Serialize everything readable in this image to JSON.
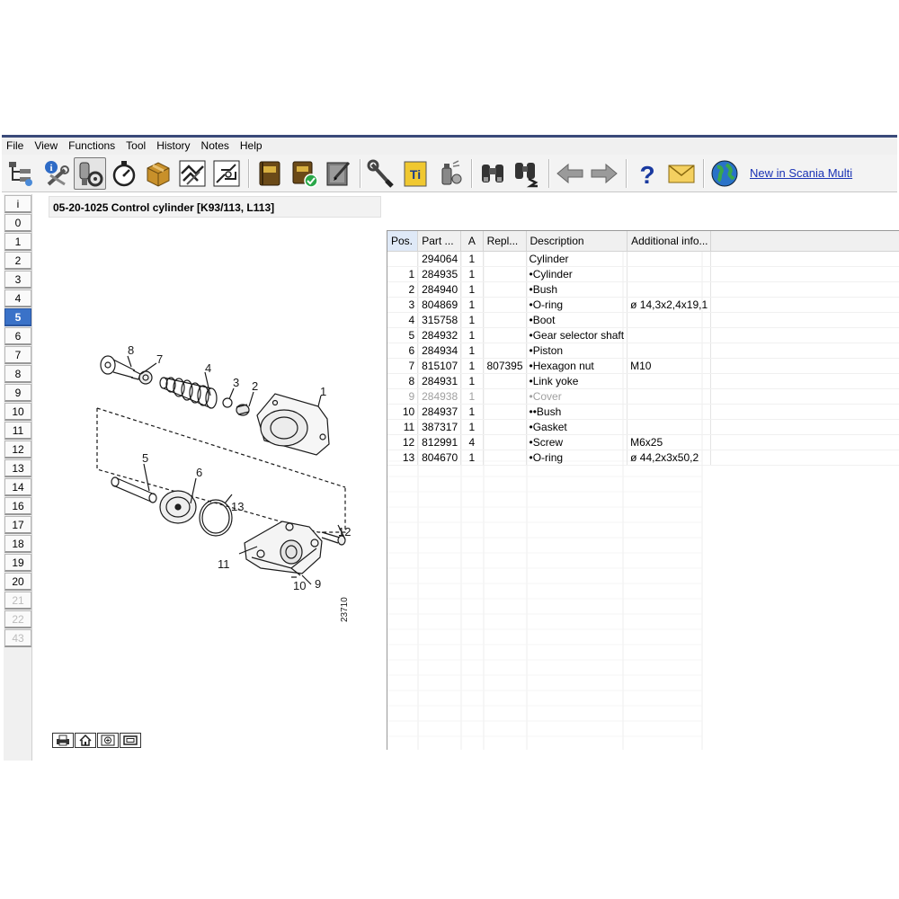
{
  "menu": [
    "File",
    "View",
    "Functions",
    "Tool",
    "History",
    "Notes",
    "Help"
  ],
  "toolbar": {
    "buttons": [
      "tree-structure-icon",
      "info-tools-icon",
      "engine-parts-icon",
      "stopwatch-icon",
      "package-box-icon",
      "handshake-icon",
      "drawing-exploded-icon",
      "order-book-icon",
      "order-book-check-icon",
      "notes-pen-icon",
      "wrench-icon",
      "ti-icon",
      "spray-can-icon",
      "binoculars-icon",
      "binoculars-search-icon",
      "arrow-left-icon",
      "arrow-right-icon",
      "question-icon",
      "envelope-icon",
      "globe-icon"
    ],
    "news_link": "New in Scania Multi"
  },
  "chapters": [
    {
      "label": "i",
      "state": "normal"
    },
    {
      "label": "0",
      "state": "normal"
    },
    {
      "label": "1",
      "state": "normal"
    },
    {
      "label": "2",
      "state": "normal"
    },
    {
      "label": "3",
      "state": "normal"
    },
    {
      "label": "4",
      "state": "normal"
    },
    {
      "label": "5",
      "state": "selected"
    },
    {
      "label": "6",
      "state": "normal"
    },
    {
      "label": "7",
      "state": "normal"
    },
    {
      "label": "8",
      "state": "normal"
    },
    {
      "label": "9",
      "state": "normal"
    },
    {
      "label": "10",
      "state": "normal"
    },
    {
      "label": "11",
      "state": "normal"
    },
    {
      "label": "12",
      "state": "normal"
    },
    {
      "label": "13",
      "state": "normal"
    },
    {
      "label": "14",
      "state": "normal"
    },
    {
      "label": "16",
      "state": "normal"
    },
    {
      "label": "17",
      "state": "normal"
    },
    {
      "label": "18",
      "state": "normal"
    },
    {
      "label": "19",
      "state": "normal"
    },
    {
      "label": "20",
      "state": "normal"
    },
    {
      "label": "21",
      "state": "disabled"
    },
    {
      "label": "22",
      "state": "disabled"
    },
    {
      "label": "43",
      "state": "disabled"
    }
  ],
  "page_title": "05-20-1025 Control cylinder [K93/113, L113]",
  "illustration": {
    "drawing_number": "23710",
    "callouts": [
      "1",
      "2",
      "3",
      "4",
      "5",
      "6",
      "7",
      "8",
      "9",
      "10",
      "11",
      "12",
      "13"
    ]
  },
  "zoom_tools": [
    "print-icon",
    "home-icon",
    "zoom-in-icon",
    "fit-window-icon"
  ],
  "table": {
    "columns": [
      "Pos.",
      "Part ...",
      "A",
      "Repl...",
      "Description",
      "Additional info..."
    ],
    "rows": [
      {
        "pos": "",
        "part": "294064",
        "a": "1",
        "repl": "",
        "desc": "Cylinder",
        "info": "",
        "dim": false
      },
      {
        "pos": "1",
        "part": "284935",
        "a": "1",
        "repl": "",
        "desc": "•Cylinder",
        "info": "",
        "dim": false
      },
      {
        "pos": "2",
        "part": "284940",
        "a": "1",
        "repl": "",
        "desc": "•Bush",
        "info": "",
        "dim": false
      },
      {
        "pos": "3",
        "part": "804869",
        "a": "1",
        "repl": "",
        "desc": "•O-ring",
        "info": "ø 14,3x2,4x19,1",
        "dim": false
      },
      {
        "pos": "4",
        "part": "315758",
        "a": "1",
        "repl": "",
        "desc": "•Boot",
        "info": "",
        "dim": false
      },
      {
        "pos": "5",
        "part": "284932",
        "a": "1",
        "repl": "",
        "desc": "•Gear selector shaft",
        "info": "",
        "dim": false
      },
      {
        "pos": "6",
        "part": "284934",
        "a": "1",
        "repl": "",
        "desc": "•Piston",
        "info": "",
        "dim": false
      },
      {
        "pos": "7",
        "part": "815107",
        "a": "1",
        "repl": "807395",
        "desc": "•Hexagon nut",
        "info": "M10",
        "dim": false
      },
      {
        "pos": "8",
        "part": "284931",
        "a": "1",
        "repl": "",
        "desc": "•Link yoke",
        "info": "",
        "dim": false
      },
      {
        "pos": "9",
        "part": "284938",
        "a": "1",
        "repl": "",
        "desc": "•Cover",
        "info": "",
        "dim": true
      },
      {
        "pos": "10",
        "part": "284937",
        "a": "1",
        "repl": "",
        "desc": "••Bush",
        "info": "",
        "dim": false
      },
      {
        "pos": "11",
        "part": "387317",
        "a": "1",
        "repl": "",
        "desc": "•Gasket",
        "info": "",
        "dim": false
      },
      {
        "pos": "12",
        "part": "812991",
        "a": "4",
        "repl": "",
        "desc": "•Screw",
        "info": "M6x25",
        "dim": false
      },
      {
        "pos": "13",
        "part": "804670",
        "a": "1",
        "repl": "",
        "desc": "•O-ring",
        "info": "ø 44,2x3x50,2",
        "dim": false
      }
    ]
  },
  "colors": {
    "selected_chapter": "#3a72c8",
    "link": "#1a33b5",
    "window_frame": "#3a4a7a"
  }
}
